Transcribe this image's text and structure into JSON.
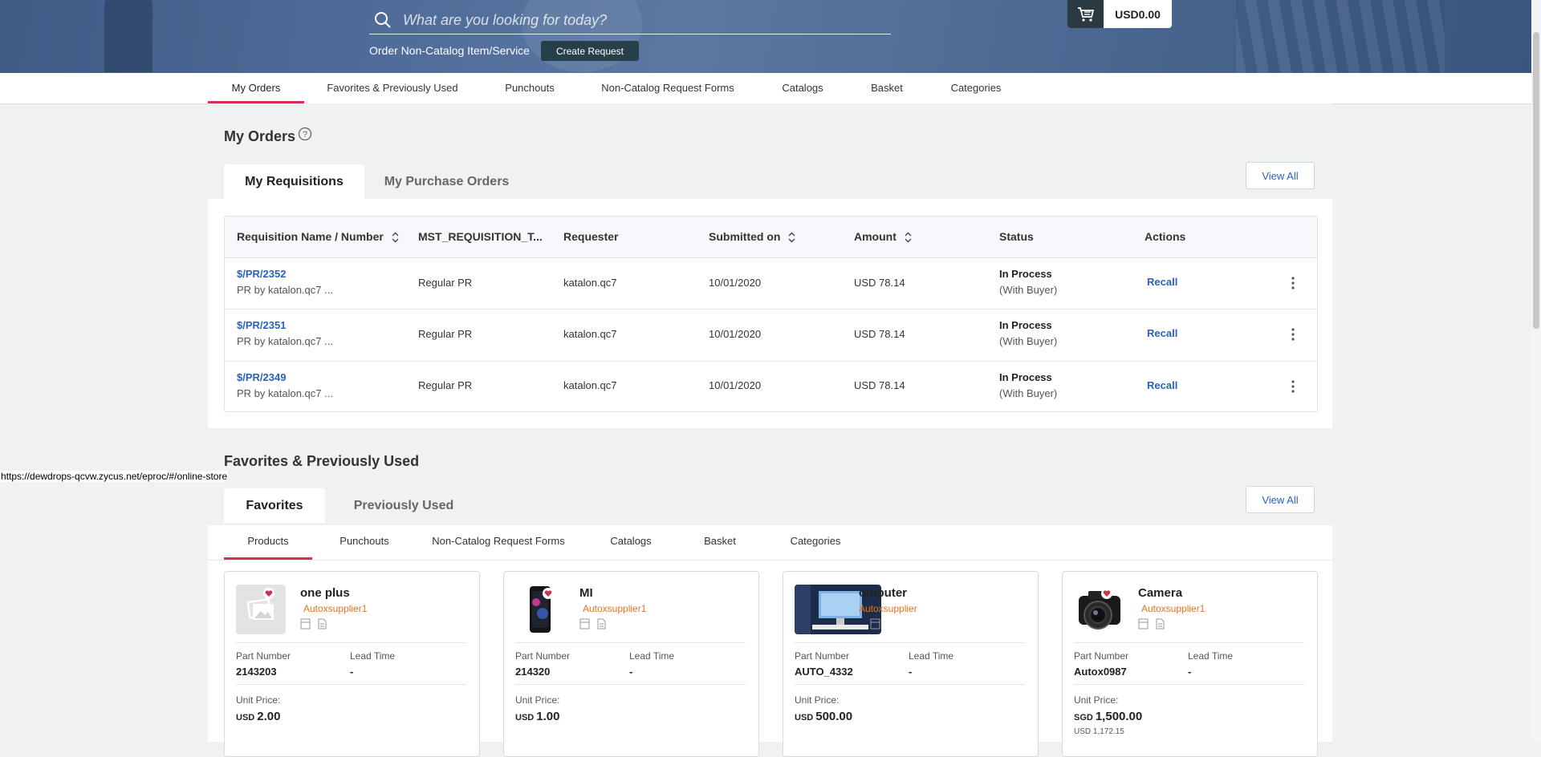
{
  "header": {
    "search_placeholder": "What are you looking for today?",
    "non_catalog_label": "Order Non-Catalog Item/Service",
    "create_request_label": "Create Request",
    "cart_amount": "USD0.00"
  },
  "topnav": {
    "tabs": [
      "My Orders",
      "Favorites & Previously Used",
      "Punchouts",
      "Non-Catalog Request Forms",
      "Catalogs",
      "Basket",
      "Categories"
    ],
    "active": "My Orders"
  },
  "orders": {
    "title": "My Orders",
    "tabs": [
      "My Requisitions",
      "My Purchase Orders"
    ],
    "view_all_label": "View All",
    "columns": [
      "Requisition Name / Number",
      "MST_REQUISITION_T...",
      "Requester",
      "Submitted on",
      "Amount",
      "Status",
      "Actions"
    ],
    "rows": [
      {
        "number": "$/PR/2352",
        "name": "PR by katalon.qc7 ...",
        "type": "Regular PR",
        "requester": "katalon.qc7",
        "submitted": "10/01/2020",
        "amount": "USD 78.14",
        "status": "In Process",
        "status_sub": "(With Buyer)",
        "action": "Recall"
      },
      {
        "number": "$/PR/2351",
        "name": "PR by katalon.qc7 ...",
        "type": "Regular PR",
        "requester": "katalon.qc7",
        "submitted": "10/01/2020",
        "amount": "USD 78.14",
        "status": "In Process",
        "status_sub": "(With Buyer)",
        "action": "Recall"
      },
      {
        "number": "$/PR/2349",
        "name": "PR by katalon.qc7 ...",
        "type": "Regular PR",
        "requester": "katalon.qc7",
        "submitted": "10/01/2020",
        "amount": "USD 78.14",
        "status": "In Process",
        "status_sub": "(With Buyer)",
        "action": "Recall"
      }
    ]
  },
  "favorites": {
    "title": "Favorites & Previously Used",
    "tabs": [
      "Favorites",
      "Previously Used"
    ],
    "view_all_label": "View All",
    "subtabs": [
      "Products",
      "Punchouts",
      "Non-Catalog Request Forms",
      "Catalogs",
      "Basket",
      "Categories"
    ],
    "part_number_label": "Part Number",
    "lead_time_label": "Lead Time",
    "unit_price_label": "Unit Price:",
    "products": [
      {
        "name": "one plus",
        "supplier": "Autoxsupplier1",
        "part_number": "2143203",
        "lead_time": "-",
        "currency": "USD",
        "price": "2.00",
        "converted": ""
      },
      {
        "name": "MI",
        "supplier": "Autoxsupplier1",
        "part_number": "214320",
        "lead_time": "-",
        "currency": "USD",
        "price": "1.00",
        "converted": ""
      },
      {
        "name": "omputer",
        "supplier": "Autoxsupplier",
        "part_number": "AUTO_4332",
        "lead_time": "-",
        "currency": "USD",
        "price": "500.00",
        "converted": ""
      },
      {
        "name": "Camera",
        "supplier": "Autoxsupplier1",
        "part_number": "Autox0987",
        "lead_time": "-",
        "currency": "SGD",
        "price": "1,500.00",
        "converted": "USD 1,172.15"
      }
    ]
  },
  "status_bar_url": "https://dewdrops-qcvw.zycus.net/eproc/#/online-store",
  "colors": {
    "accent": "#d1334f",
    "link": "#2a62b8",
    "supplier": "#e8731c",
    "dark_button": "#26404a"
  },
  "icons": [
    "search-icon",
    "cart-icon",
    "help-icon",
    "sort-icon",
    "kebab-menu-icon",
    "heart-icon",
    "product-image-icon",
    "catalog-icon",
    "document-icon"
  ]
}
